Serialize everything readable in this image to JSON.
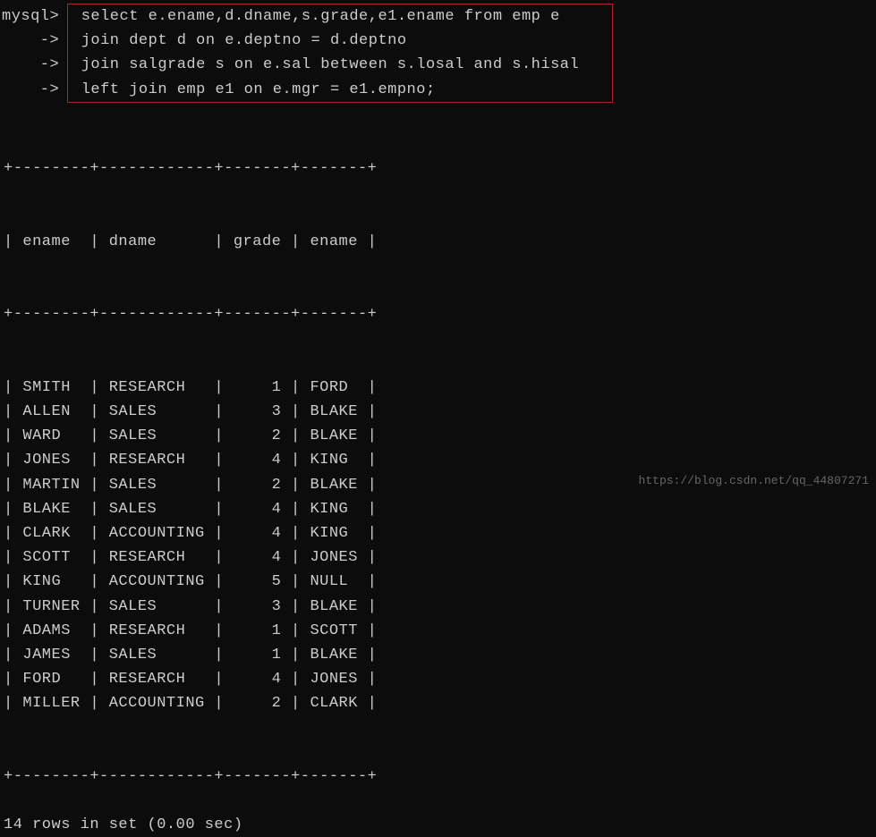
{
  "prompt": {
    "main": "mysql>",
    "cont": "    ->"
  },
  "sql": {
    "line1": " select e.ename,d.dname,s.grade,e1.ename from emp e",
    "line2": " join dept d on e.deptno = d.deptno",
    "line3": " join salgrade s on e.sal between s.losal and s.hisal",
    "line4": " left join emp e1 on e.mgr = e1.empno;"
  },
  "table": {
    "separator": "+--------+------------+-------+-------+",
    "header": "| ename  | dname      | grade | ename |",
    "columns": [
      "ename",
      "dname",
      "grade",
      "ename"
    ],
    "rows": [
      {
        "ename": "SMITH",
        "dname": "RESEARCH",
        "grade": "1",
        "mgr": "FORD"
      },
      {
        "ename": "ALLEN",
        "dname": "SALES",
        "grade": "3",
        "mgr": "BLAKE"
      },
      {
        "ename": "WARD",
        "dname": "SALES",
        "grade": "2",
        "mgr": "BLAKE"
      },
      {
        "ename": "JONES",
        "dname": "RESEARCH",
        "grade": "4",
        "mgr": "KING"
      },
      {
        "ename": "MARTIN",
        "dname": "SALES",
        "grade": "2",
        "mgr": "BLAKE"
      },
      {
        "ename": "BLAKE",
        "dname": "SALES",
        "grade": "4",
        "mgr": "KING"
      },
      {
        "ename": "CLARK",
        "dname": "ACCOUNTING",
        "grade": "4",
        "mgr": "KING"
      },
      {
        "ename": "SCOTT",
        "dname": "RESEARCH",
        "grade": "4",
        "mgr": "JONES"
      },
      {
        "ename": "KING",
        "dname": "ACCOUNTING",
        "grade": "5",
        "mgr": "NULL"
      },
      {
        "ename": "TURNER",
        "dname": "SALES",
        "grade": "3",
        "mgr": "BLAKE"
      },
      {
        "ename": "ADAMS",
        "dname": "RESEARCH",
        "grade": "1",
        "mgr": "SCOTT"
      },
      {
        "ename": "JAMES",
        "dname": "SALES",
        "grade": "1",
        "mgr": "BLAKE"
      },
      {
        "ename": "FORD",
        "dname": "RESEARCH",
        "grade": "4",
        "mgr": "JONES"
      },
      {
        "ename": "MILLER",
        "dname": "ACCOUNTING",
        "grade": "2",
        "mgr": "CLARK"
      }
    ]
  },
  "status": "14 rows in set (0.00 sec)",
  "watermark": "https://blog.csdn.net/qq_44807271",
  "chart_data": {
    "type": "table",
    "columns": [
      "ename",
      "dname",
      "grade",
      "ename"
    ],
    "rows": [
      [
        "SMITH",
        "RESEARCH",
        1,
        "FORD"
      ],
      [
        "ALLEN",
        "SALES",
        3,
        "BLAKE"
      ],
      [
        "WARD",
        "SALES",
        2,
        "BLAKE"
      ],
      [
        "JONES",
        "RESEARCH",
        4,
        "KING"
      ],
      [
        "MARTIN",
        "SALES",
        2,
        "BLAKE"
      ],
      [
        "BLAKE",
        "SALES",
        4,
        "KING"
      ],
      [
        "CLARK",
        "ACCOUNTING",
        4,
        "KING"
      ],
      [
        "SCOTT",
        "RESEARCH",
        4,
        "JONES"
      ],
      [
        "KING",
        "ACCOUNTING",
        5,
        "NULL"
      ],
      [
        "TURNER",
        "SALES",
        3,
        "BLAKE"
      ],
      [
        "ADAMS",
        "RESEARCH",
        1,
        "SCOTT"
      ],
      [
        "JAMES",
        "SALES",
        1,
        "BLAKE"
      ],
      [
        "FORD",
        "RESEARCH",
        4,
        "JONES"
      ],
      [
        "MILLER",
        "ACCOUNTING",
        2,
        "CLARK"
      ]
    ]
  }
}
